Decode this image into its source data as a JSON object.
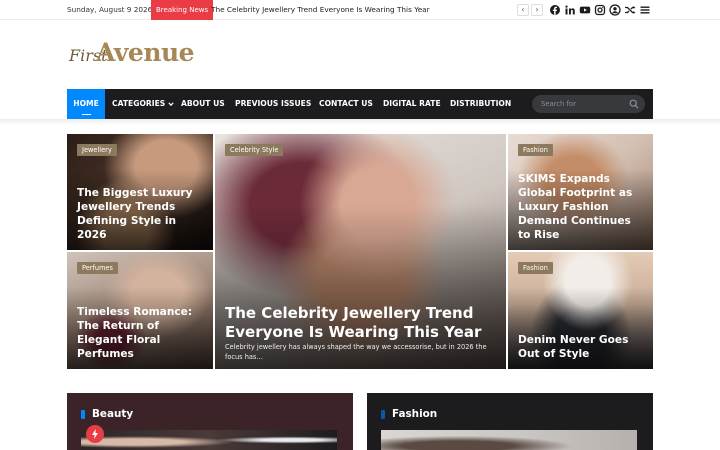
{
  "topbar": {
    "date": "Sunday, August 9 2026",
    "breaking_label": "Breaking News",
    "ticker": "The Celebrity Jewellery Trend Everyone Is Wearing This Year",
    "prev": "‹",
    "next": "›",
    "social_icons": [
      "facebook-icon",
      "linkedin-icon",
      "youtube-icon",
      "instagram-icon",
      "user-icon",
      "random-icon",
      "menu-icon"
    ]
  },
  "logo": {
    "first": "First",
    "avenue": "Avenue"
  },
  "nav": {
    "items": [
      "HOME",
      "CATEGORIES",
      "ABOUT US",
      "PREVIOUS ISSUES",
      "CONTACT US",
      "DIGITAL RATE",
      "DISTRIBUTION"
    ],
    "search_placeholder": "Search for"
  },
  "grid": {
    "top_left": {
      "category": "Jewellery",
      "title": "The Biggest Luxury Jewellery Trends Defining Style in 2026"
    },
    "bottom_left": {
      "category": "Perfumes",
      "title": "Timeless Romance: The Return of Elegant Floral Perfumes"
    },
    "featured": {
      "category": "Celebrity Style",
      "title": "The Celebrity Jewellery Trend Everyone Is Wearing This Year",
      "excerpt": "Celebrity jewellery has always shaped the way we accessorise, but in 2026 the focus has…"
    },
    "top_right": {
      "category": "Fashion",
      "title": "SKIMS Expands Global Footprint as Luxury Fashion Demand Continues to Rise"
    },
    "bottom_right": {
      "category": "Fashion",
      "title": "Denim Never Goes Out of Style"
    }
  },
  "sections": [
    {
      "title": "Beauty",
      "accent": "#0088ff"
    },
    {
      "title": "Fashion",
      "accent": "#0088ff"
    }
  ],
  "colors": {
    "accent": "#0088ff",
    "breaking": "#ea3c45",
    "nav_bg": "#1c1c1e",
    "badge": "#8d7a5e"
  }
}
